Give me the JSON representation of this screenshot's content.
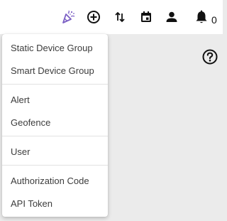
{
  "topbar": {
    "icons": [
      {
        "name": "party-popper-icon",
        "color": "#7b5fc4"
      },
      {
        "name": "add-circle-icon",
        "color": "#111111"
      },
      {
        "name": "swap-vertical-icon",
        "color": "#111111"
      },
      {
        "name": "calendar-icon",
        "color": "#111111"
      },
      {
        "name": "user-icon",
        "color": "#111111"
      },
      {
        "name": "bell-icon",
        "color": "#111111"
      }
    ],
    "notification_count": "0"
  },
  "create_menu": {
    "items": [
      {
        "label": "Static Device Group"
      },
      {
        "label": "Smart Device Group"
      },
      {
        "label": "Alert"
      },
      {
        "label": "Geofence"
      },
      {
        "label": "User"
      },
      {
        "label": "Authorization Code"
      },
      {
        "label": "API Token"
      }
    ]
  },
  "help": {
    "icon": "help-circle-icon"
  }
}
